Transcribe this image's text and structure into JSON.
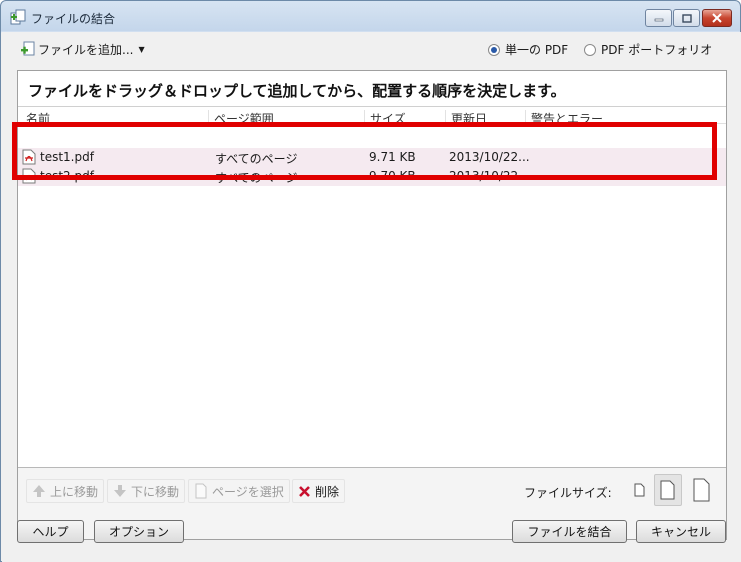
{
  "window": {
    "title": "ファイルの結合"
  },
  "toolbar_top": {
    "add_files_label": "ファイルを追加...",
    "radio_single_label": "単一の PDF",
    "radio_portfolio_label": "PDF ポートフォリオ",
    "selected_mode": "single"
  },
  "instruction": "ファイルをドラッグ＆ドロップして追加してから、配置する順序を決定します。",
  "columns": [
    "名前",
    "ページ範囲",
    "サイズ",
    "更新日",
    "警告とエラー"
  ],
  "files": [
    {
      "name": "test1.pdf",
      "pages": "すべてのページ",
      "size": "9.71 KB",
      "modified": "2013/10/22..."
    },
    {
      "name": "test2.pdf",
      "pages": "すべてのページ",
      "size": "9.70 KB",
      "modified": "2013/10/22..."
    }
  ],
  "list_toolbar": {
    "move_up": "上に移動",
    "move_down": "下に移動",
    "select_pages": "ページを選択",
    "delete": "削除",
    "file_size_label": "ファイルサイズ:"
  },
  "buttons": {
    "help": "ヘルプ",
    "options": "オプション",
    "combine": "ファイルを結合",
    "cancel": "キャンセル"
  },
  "colors": {
    "highlight": "#e00000",
    "row_selected": "#f5eaf0",
    "delete_icon": "#c8102e"
  }
}
